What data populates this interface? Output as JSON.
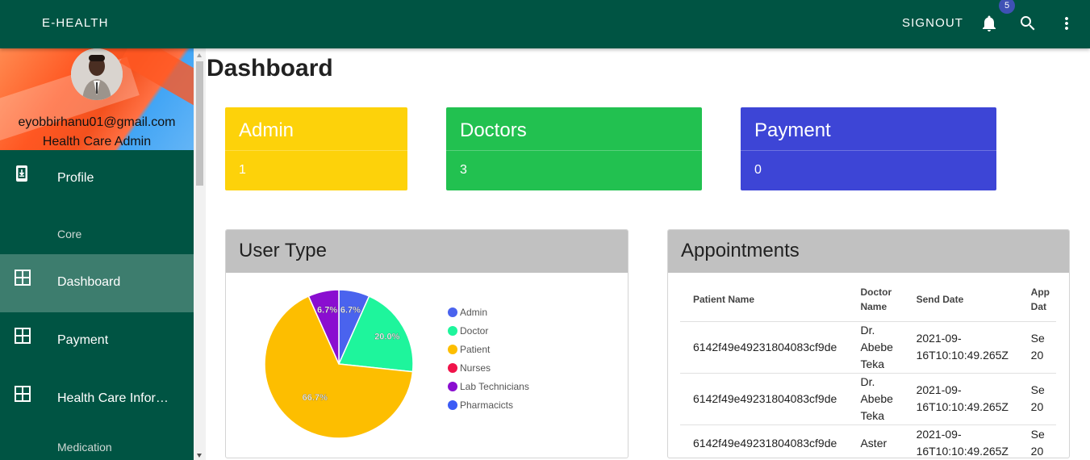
{
  "appbar": {
    "brand": "E-HEALTH",
    "signout": "SIGNOUT",
    "notification_count": "5"
  },
  "profile": {
    "email": "eyobbirhanu01@gmail.com",
    "role": "Health Care Admin"
  },
  "sidebar": {
    "items": [
      {
        "label": "Profile",
        "icon": "phone-download-icon"
      },
      {
        "label": "Dashboard",
        "icon": "grid-icon"
      },
      {
        "label": "Payment",
        "icon": "grid-icon"
      },
      {
        "label": "Health Care Information",
        "icon": "grid-icon"
      }
    ],
    "section_core": "Core",
    "section_medication": "Medication"
  },
  "page": {
    "title": "Dashboard"
  },
  "stats": [
    {
      "title": "Admin",
      "value": "1",
      "color": "#fdd20a"
    },
    {
      "title": "Doctors",
      "value": "3",
      "color": "#22c150"
    },
    {
      "title": "Payment",
      "value": "0",
      "color": "#3d45d6"
    }
  ],
  "user_type_panel": {
    "title": "User Type"
  },
  "chart_data": {
    "type": "pie",
    "categories": [
      "Admin",
      "Doctor",
      "Patient",
      "Nurses",
      "Lab Technicians",
      "Pharmacicts"
    ],
    "values": [
      6.7,
      20.0,
      66.7,
      0,
      6.7,
      0
    ],
    "labels": [
      "6.7%",
      "20.0%",
      "66.7%",
      "",
      "6.7%",
      ""
    ],
    "colors": [
      "#4a63ee",
      "#1ef59c",
      "#fdbe00",
      "#f0134a",
      "#8a0ed0",
      "#3b5bf5"
    ],
    "legend_position": "right"
  },
  "appointments_panel": {
    "title": "Appointments",
    "columns": [
      "Patient Name",
      "Doctor Name",
      "Send Date",
      "Appointment Date"
    ],
    "column_visible": [
      "Patient Name",
      "Doctor\nName",
      "Send Date",
      "App\nDat"
    ],
    "rows": [
      {
        "patient": "6142f49e49231804083cf9de",
        "doctor": "Dr. Abebe Teka",
        "send_date": "2021-09-16T10:10:49.265Z",
        "appt_date": "Se 20"
      },
      {
        "patient": "6142f49e49231804083cf9de",
        "doctor": "Dr. Abebe Teka",
        "send_date": "2021-09-16T10:10:49.265Z",
        "appt_date": "Se 20"
      },
      {
        "patient": "6142f49e49231804083cf9de",
        "doctor": "Aster",
        "send_date": "2021-09-16T10:10:49.265Z",
        "appt_date": "Se 20"
      }
    ]
  }
}
